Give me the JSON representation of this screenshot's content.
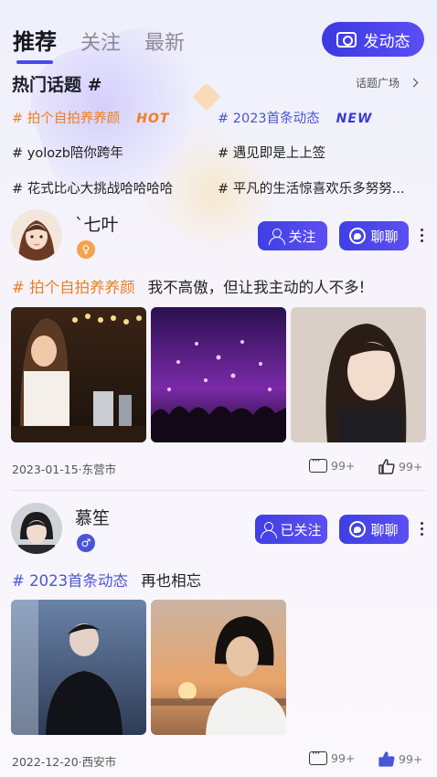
{
  "tabs": [
    {
      "label": "推荐",
      "active": true
    },
    {
      "label": "关注",
      "active": false
    },
    {
      "label": "最新",
      "active": false
    }
  ],
  "post_button": {
    "label": "发动态",
    "icon": "camera-icon"
  },
  "hot_topics": {
    "title": "热门话题 #",
    "plaza_label": "话题广场",
    "items": [
      {
        "text": "# 拍个自拍养养颜",
        "tag": "HOT",
        "color": "orange"
      },
      {
        "text": "# 2023首条动态",
        "tag": "NEW",
        "color": "blue"
      },
      {
        "text": "# yolozb陪你跨年",
        "tag": "",
        "color": "default"
      },
      {
        "text": "# 遇见即是上上签",
        "tag": "",
        "color": "default"
      },
      {
        "text": "# 花式比心大挑战哈哈哈哈",
        "tag": "",
        "color": "default"
      },
      {
        "text": "# 平凡的生活惊喜欢乐多努努...",
        "tag": "",
        "color": "default"
      }
    ]
  },
  "posts": [
    {
      "username": "`七叶",
      "gender": "female",
      "gender_symbol": "♀",
      "follow_label": "关注",
      "chat_label": "聊聊",
      "topic": "# 拍个自拍养养颜",
      "text": "我不高傲，但让我主动的人不多!",
      "meta": "2023-01-15·东营市",
      "comments": "99+",
      "likes": "99+",
      "photos": [
        "bartender-photo",
        "concert-photo",
        "portrait-photo"
      ]
    },
    {
      "username": "慕笙",
      "gender": "male",
      "gender_symbol": "♂",
      "follow_label": "已关注",
      "chat_label": "聊聊",
      "topic": "# 2023首条动态",
      "text": "再也相忘",
      "meta": "2022-12-20·西安市",
      "comments": "99+",
      "likes": "99+",
      "photos": [
        "night-man-photo",
        "sunset-man-photo"
      ]
    }
  ],
  "colors": {
    "accent": "#4a4af0",
    "hot": "#f07d1e",
    "topic_blue": "#4a55d8"
  }
}
